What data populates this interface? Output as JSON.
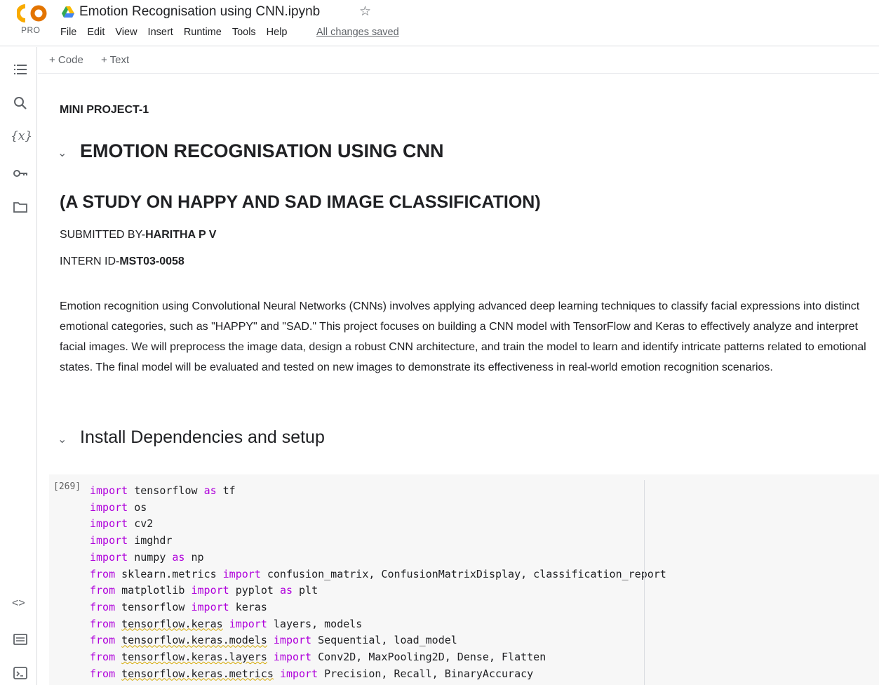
{
  "header": {
    "logo_text": "CO",
    "plan": "PRO",
    "notebook_title": "Emotion Recognisation using CNN.ipynb",
    "save_status": "All changes saved",
    "menu": [
      "File",
      "Edit",
      "View",
      "Insert",
      "Runtime",
      "Tools",
      "Help"
    ]
  },
  "toolbar": {
    "add_code": "+ Code",
    "add_text": "+ Text"
  },
  "sidebar_icons": [
    "table-of-contents-icon",
    "search-icon",
    "variables-icon",
    "secrets-key-icon",
    "files-folder-icon",
    "code-snippets-icon",
    "command-palette-icon",
    "terminal-icon"
  ],
  "doc": {
    "mini_project": "MINI PROJECT-1",
    "heading": "EMOTION RECOGNISATION USING CNN",
    "subheading": "(A STUDY ON HAPPY AND SAD IMAGE CLASSIFICATION)",
    "submitted_prefix": "SUBMITTED BY-",
    "submitted_name": "HARITHA P V",
    "intern_prefix": "INTERN ID-",
    "intern_id": "MST03-0058",
    "description": "Emotion recognition using Convolutional Neural Networks (CNNs) involves applying advanced deep learning techniques to classify facial expressions into distinct emotional categories, such as \"HAPPY\" and \"SAD.\" This project focuses on building a CNN model with TensorFlow and Keras to effectively analyze and interpret facial images. We will preprocess the image data, design a robust CNN architecture, and train the model to learn and identify intricate patterns related to emotional states. The final model will be evaluated and tested on new images to demonstrate its effectiveness in real-world emotion recognition scenarios.",
    "section_heading": "Install Dependencies and setup"
  },
  "cell": {
    "execution_count": "[269]",
    "lines": [
      [
        {
          "t": "import",
          "k": true
        },
        {
          "t": " tensorflow "
        },
        {
          "t": "as",
          "k": true
        },
        {
          "t": " tf"
        }
      ],
      [
        {
          "t": "import",
          "k": true
        },
        {
          "t": " os"
        }
      ],
      [
        {
          "t": "import",
          "k": true
        },
        {
          "t": " cv2"
        }
      ],
      [
        {
          "t": "import",
          "k": true
        },
        {
          "t": " imghdr"
        }
      ],
      [
        {
          "t": "import",
          "k": true
        },
        {
          "t": " numpy "
        },
        {
          "t": "as",
          "k": true
        },
        {
          "t": " np"
        }
      ],
      [
        {
          "t": "from",
          "k": true
        },
        {
          "t": " sklearn.metrics "
        },
        {
          "t": "import",
          "k": true
        },
        {
          "t": " confusion_matrix, ConfusionMatrixDisplay, classification_report"
        }
      ],
      [
        {
          "t": "from",
          "k": true
        },
        {
          "t": " matplotlib "
        },
        {
          "t": "import",
          "k": true
        },
        {
          "t": " pyplot "
        },
        {
          "t": "as",
          "k": true
        },
        {
          "t": " plt"
        }
      ],
      [
        {
          "t": "from",
          "k": true
        },
        {
          "t": " tensorflow "
        },
        {
          "t": "import",
          "k": true
        },
        {
          "t": " keras"
        }
      ],
      [
        {
          "t": "from",
          "k": true
        },
        {
          "t": " "
        },
        {
          "t": "tensorflow.keras",
          "s": true
        },
        {
          "t": " "
        },
        {
          "t": "import",
          "k": true
        },
        {
          "t": " layers, models"
        }
      ],
      [
        {
          "t": "from",
          "k": true
        },
        {
          "t": " "
        },
        {
          "t": "tensorflow.keras.models",
          "s": true
        },
        {
          "t": " "
        },
        {
          "t": "import",
          "k": true
        },
        {
          "t": " Sequential, load_model"
        }
      ],
      [
        {
          "t": "from",
          "k": true
        },
        {
          "t": " "
        },
        {
          "t": "tensorflow.keras.layers",
          "s": true
        },
        {
          "t": " "
        },
        {
          "t": "import",
          "k": true
        },
        {
          "t": " Conv2D, MaxPooling2D, Dense, Flatten"
        }
      ],
      [
        {
          "t": "from",
          "k": true
        },
        {
          "t": " "
        },
        {
          "t": "tensorflow.keras.metrics",
          "s": true
        },
        {
          "t": " "
        },
        {
          "t": "import",
          "k": true
        },
        {
          "t": " Precision, Recall, BinaryAccuracy"
        }
      ]
    ]
  },
  "colors": {
    "keyword": "#af00db",
    "logo_orange": "#f9ab00",
    "logo_amber": "#e37400"
  }
}
